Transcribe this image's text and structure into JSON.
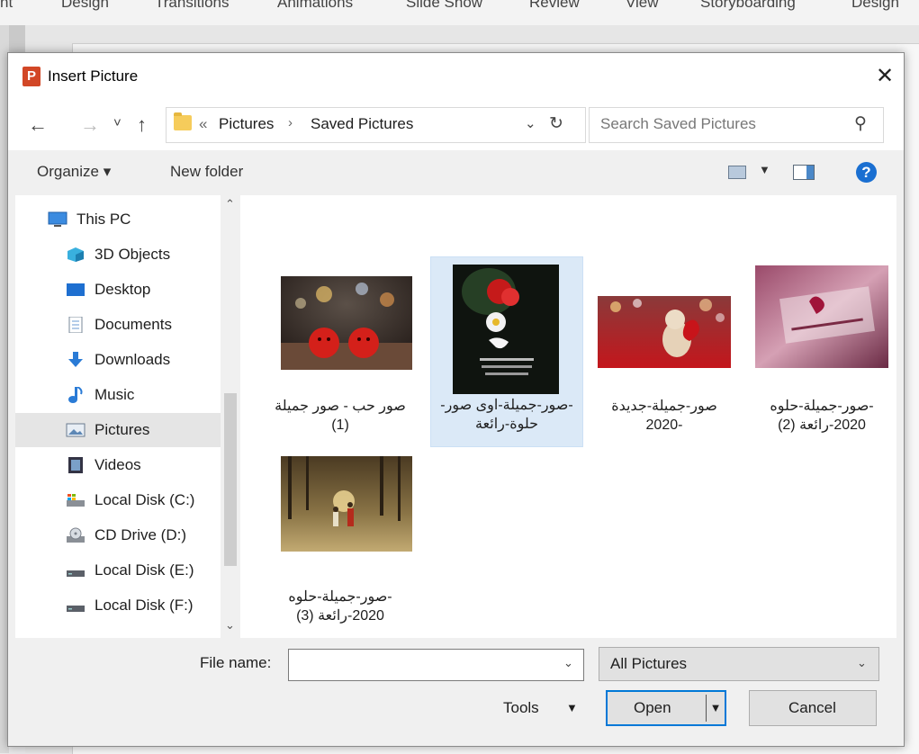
{
  "ribbon_tabs": [
    "nt",
    "Design",
    "Transitions",
    "Animations",
    "Slide Show",
    "Review",
    "View",
    "Storyboarding",
    "Design"
  ],
  "dialog": {
    "app_icon_letter": "P",
    "title": "Insert Picture",
    "close_glyph": "✕"
  },
  "nav": {
    "back_glyph": "←",
    "forward_glyph": "→",
    "recent_glyph": "˅",
    "up_glyph": "↑",
    "breadcrumb_chevron": "«",
    "breadcrumb": [
      "Pictures",
      "Saved Pictures"
    ],
    "breadcrumb_sep": "›",
    "address_drop_glyph": "⌄",
    "refresh_glyph": "↻",
    "search_placeholder": "Search Saved Pictures",
    "search_glyph": "⚲"
  },
  "toolbar": {
    "organize": "Organize ▾",
    "new_folder": "New folder",
    "view_drop": "▼",
    "help": "?"
  },
  "sidebar": {
    "items": [
      {
        "label": "This PC",
        "icon": "pc-icon"
      },
      {
        "label": "3D Objects",
        "icon": "cube-icon"
      },
      {
        "label": "Desktop",
        "icon": "desktop-icon"
      },
      {
        "label": "Documents",
        "icon": "document-icon"
      },
      {
        "label": "Downloads",
        "icon": "download-icon"
      },
      {
        "label": "Music",
        "icon": "music-icon"
      },
      {
        "label": "Pictures",
        "icon": "pictures-icon",
        "selected": true
      },
      {
        "label": "Videos",
        "icon": "video-icon"
      },
      {
        "label": "Local Disk (C:)",
        "icon": "drive-c-icon"
      },
      {
        "label": "CD Drive (D:)",
        "icon": "cd-icon"
      },
      {
        "label": "Local Disk (E:)",
        "icon": "drive-icon"
      },
      {
        "label": "Local Disk (F:)",
        "icon": "drive-icon"
      }
    ],
    "scroll_up": "⌃",
    "scroll_down": "⌄"
  },
  "files": [
    {
      "label": "صور حب - صور جميلة (1)"
    },
    {
      "label": "-صور-جميلة-اوى صور-حلوة-رائعة",
      "selected": true
    },
    {
      "label": "صور-جميلة-جديدة -2020"
    },
    {
      "label": "-صور-جميلة-حلوه 2020-رائعة (2)"
    },
    {
      "label": "-صور-جميلة-حلوه 2020-رائعة (3)"
    }
  ],
  "footer": {
    "file_name_label": "File name:",
    "file_name_value": "",
    "filter": "All Pictures",
    "tools": "Tools",
    "drop_glyph": "▼",
    "small_drop": "⌄",
    "open": "Open",
    "cancel": "Cancel"
  },
  "colors": {
    "accent": "#0078d7",
    "selection": "#dbe9f7",
    "app_icon": "#d24726"
  }
}
